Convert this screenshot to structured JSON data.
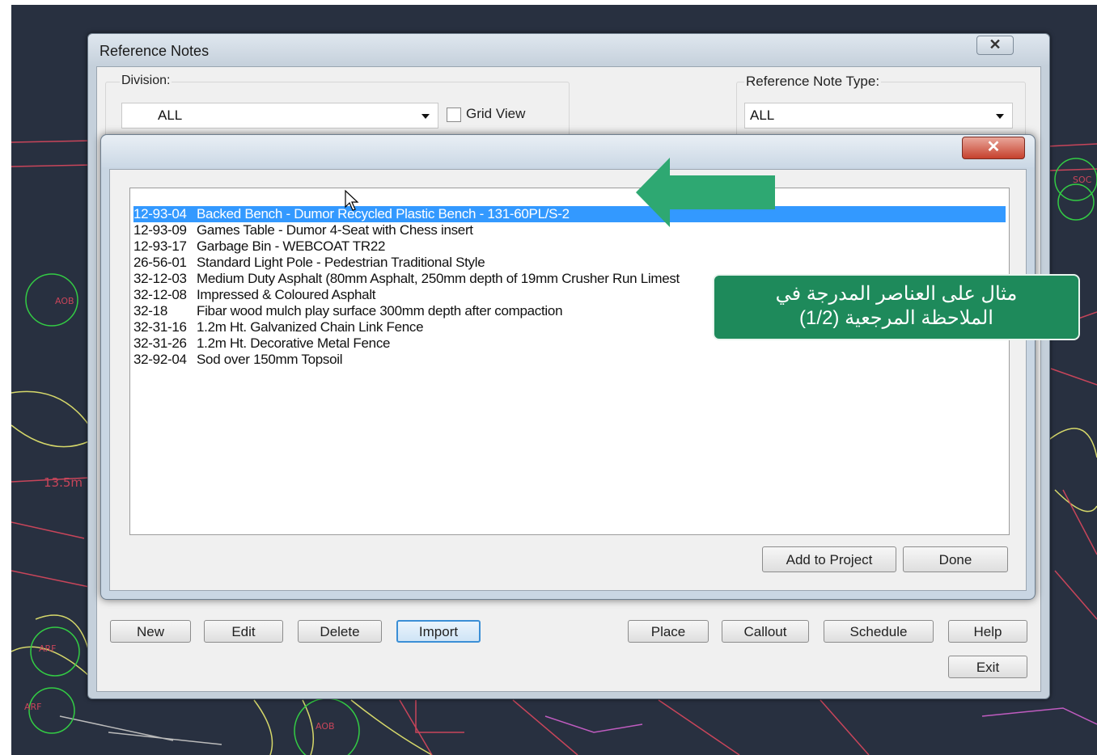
{
  "main_window": {
    "title": "Reference Notes",
    "close_label": "✕",
    "division_label": "Division:",
    "division_value": "ALL",
    "grid_view_label": "Grid View",
    "ref_type_label": "Reference Note Type:",
    "ref_type_value": "ALL",
    "buttons": {
      "new": "New",
      "edit": "Edit",
      "delete": "Delete",
      "import": "Import",
      "place": "Place",
      "callout": "Callout",
      "schedule": "Schedule",
      "help": "Help",
      "exit": "Exit"
    }
  },
  "sub_window": {
    "close_label": "✕",
    "items": [
      {
        "code": "12-93-04",
        "text": "Backed Bench - Dumor Recycled Plastic Bench - 131-60PL/S-2",
        "selected": true
      },
      {
        "code": "12-93-09",
        "text": "Games Table - Dumor 4-Seat with Chess insert",
        "selected": false
      },
      {
        "code": "12-93-17",
        "text": "Garbage Bin - WEBCOAT TR22",
        "selected": false
      },
      {
        "code": "26-56-01",
        "text": "Standard Light Pole - Pedestrian Traditional Style",
        "selected": false
      },
      {
        "code": "32-12-03",
        "text": "Medium Duty Asphalt (80mm Asphalt, 250mm depth of 19mm Crusher Run Limest",
        "selected": false
      },
      {
        "code": "32-12-08",
        "text": "Impressed & Coloured Asphalt",
        "selected": false
      },
      {
        "code": "32-18",
        "text": "Fibar wood mulch play surface 300mm depth after compaction",
        "selected": false
      },
      {
        "code": "32-31-16",
        "text": "1.2m Ht. Galvanized Chain Link Fence",
        "selected": false
      },
      {
        "code": "32-31-26",
        "text": "1.2m Ht. Decorative Metal Fence",
        "selected": false
      },
      {
        "code": "32-92-04",
        "text": "Sod over 150mm Topsoil",
        "selected": false
      }
    ],
    "add_to_project": "Add to Project",
    "done": "Done"
  },
  "annotation": {
    "callout_line1": "مثال على العناصر المدرجة في",
    "callout_line2": "الملاحظة المرجعية (1/2)",
    "arrow_color": "#2ea872",
    "callout_color": "#1e8a5b"
  },
  "background": {
    "cad_labels": [
      "AOB",
      "ARF",
      "ARF",
      "AOB",
      "13.5m",
      "SOC"
    ]
  },
  "colors": {
    "selection": "#3399ff",
    "cad_background": "#283040"
  }
}
